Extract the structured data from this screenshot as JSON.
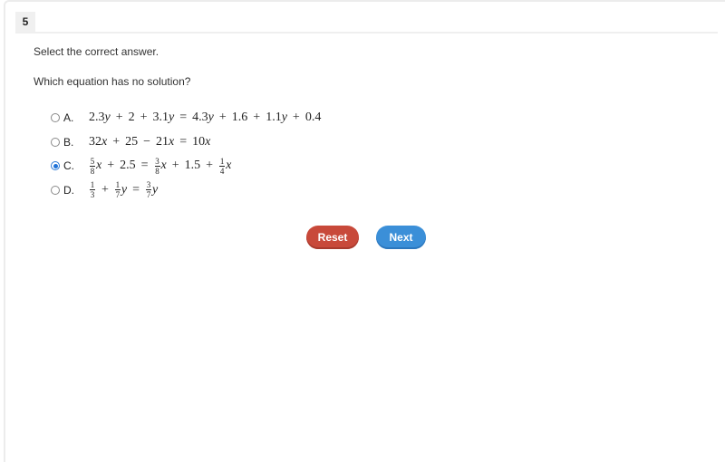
{
  "question": {
    "number": "5",
    "instruction": "Select the correct answer.",
    "prompt": "Which equation has no solution?"
  },
  "options": [
    {
      "letter": "A.",
      "selected": false,
      "equation": "2.3y + 2 + 3.1y = 4.3y + 1.6 + 1.1y + 0.4",
      "parts": {
        "t1": "2.3",
        "v": "y",
        "o1": "+",
        "t2": "2",
        "o2": "+",
        "t3": "3.1",
        "eq": "=",
        "t4": "4.3",
        "o3": "+",
        "t5": "1.6",
        "o4": "+",
        "t6": "1.1",
        "o5": "+",
        "t7": "0.4"
      }
    },
    {
      "letter": "B.",
      "selected": false,
      "equation": "32x + 25 − 21x = 10x",
      "parts": {
        "t1": "32",
        "v": "x",
        "o1": "+",
        "t2": "25",
        "o2": "−",
        "t3": "21",
        "eq": "=",
        "t4": "10"
      }
    },
    {
      "letter": "C.",
      "selected": true,
      "equation": "(5/8)x + 2.5 = (3/8)x + 1.5 + (1/4)x",
      "parts": {
        "n1": "5",
        "d1": "8",
        "v": "x",
        "o1": "+",
        "t1": "2.5",
        "eq": "=",
        "n2": "3",
        "d2": "8",
        "o2": "+",
        "t2": "1.5",
        "o3": "+",
        "n3": "1",
        "d3": "4"
      }
    },
    {
      "letter": "D.",
      "selected": false,
      "equation": "1/3 + (1/7)y = (3/7)y",
      "parts": {
        "n1": "1",
        "d1": "3",
        "o1": "+",
        "n2": "1",
        "d2": "7",
        "v": "y",
        "eq": "=",
        "n3": "3",
        "d3": "7"
      }
    }
  ],
  "buttons": {
    "reset": "Reset",
    "next": "Next"
  },
  "colors": {
    "reset": "#c8493a",
    "next": "#3b8fd8",
    "radio_selected": "#1f73d8"
  }
}
